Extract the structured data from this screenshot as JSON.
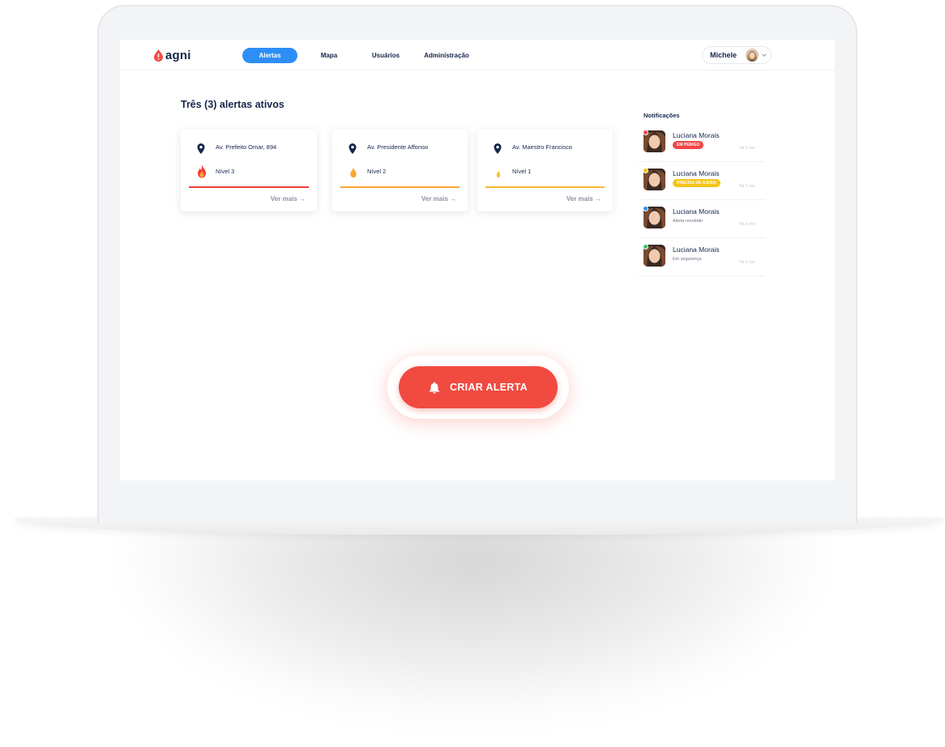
{
  "app": {
    "name": "agni"
  },
  "nav": {
    "items": [
      {
        "label": "Alertas",
        "active": true
      },
      {
        "label": "Mapa",
        "active": false
      },
      {
        "label": "Usuários",
        "active": false
      },
      {
        "label": "Administração",
        "active": false
      }
    ]
  },
  "user": {
    "name": "Michele"
  },
  "main": {
    "title": "Três (3) alertas ativos",
    "alerts": [
      {
        "address": "Av. Prefeito Omar, 894",
        "level": "Nível 3",
        "level_color": "#ef3e36",
        "more": "Ver mais →"
      },
      {
        "address": "Av. Presidente Affonso",
        "level": "Nível 2",
        "level_color": "#f7a833",
        "more": "Ver mais →"
      },
      {
        "address": "Av. Maestro Francisco",
        "level": "Nível 1",
        "level_color": "#f7b733",
        "more": "Ver mais →"
      }
    ]
  },
  "notifications": {
    "title": "Notificações",
    "items": [
      {
        "name": "Luciana Morais",
        "status": "EM PERIGO",
        "badge_color": "#f04545",
        "dot_color": "#f04545",
        "time": "Há 1 min",
        "is_badge": true
      },
      {
        "name": "Luciana Morais",
        "status": "PRECISA DE AJUDA",
        "badge_color": "#f5c518",
        "dot_color": "#f5c518",
        "time": "Há 1 min",
        "is_badge": true
      },
      {
        "name": "Luciana Morais",
        "status": "Alerta recebido",
        "dot_color": "#2d8ff6",
        "time": "Há 4 min",
        "is_badge": false
      },
      {
        "name": "Luciana Morais",
        "status": "Em segurança",
        "dot_color": "#3cc26b",
        "time": "Há 4 min",
        "is_badge": false
      }
    ]
  },
  "cta": {
    "label": "CRIAR ALERTA",
    "icon": "bell-icon"
  },
  "colors": {
    "primary": "#2d8ff6",
    "danger": "#f14a41",
    "text": "#15264a"
  }
}
